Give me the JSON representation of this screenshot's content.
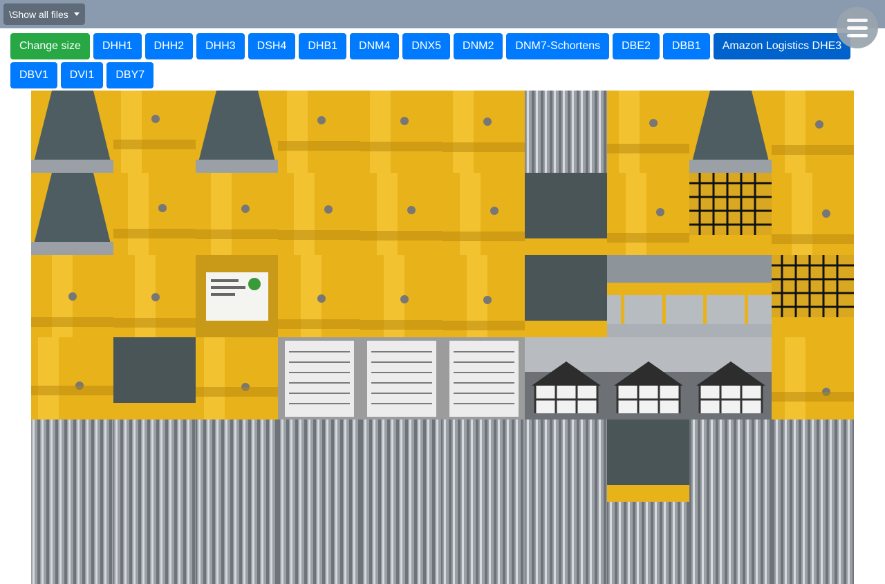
{
  "topbar": {
    "show_files_label": "\\Show all files"
  },
  "menu": {
    "icon": "hamburger-menu-icon"
  },
  "buttons": [
    {
      "label": "Change size",
      "style": "success"
    },
    {
      "label": "DHH1",
      "style": "primary"
    },
    {
      "label": "DHH2",
      "style": "primary"
    },
    {
      "label": "DHH3",
      "style": "primary"
    },
    {
      "label": "DSH4",
      "style": "primary"
    },
    {
      "label": "DHB1",
      "style": "primary"
    },
    {
      "label": "DNM4",
      "style": "primary"
    },
    {
      "label": "DNX5",
      "style": "primary"
    },
    {
      "label": "DNM2",
      "style": "primary"
    },
    {
      "label": "DNM7-Schortens",
      "style": "primary"
    },
    {
      "label": "DBE2",
      "style": "primary"
    },
    {
      "label": "DBB1",
      "style": "primary"
    },
    {
      "label": "Amazon Logistics DHE3",
      "style": "active"
    },
    {
      "label": "DBV1",
      "style": "primary"
    },
    {
      "label": "DVI1",
      "style": "primary"
    },
    {
      "label": "DBY7",
      "style": "primary"
    }
  ],
  "colors": {
    "topbar": "#8a9bb0",
    "primary": "#007bff",
    "success": "#28a745",
    "active": "#0062cc",
    "conveyor_yellow": "#e8b21a"
  },
  "thumbnails": [
    "c",
    "y",
    "c",
    "y",
    "y",
    "y",
    "r",
    "y",
    "c",
    "y",
    "c",
    "y",
    "y",
    "y",
    "y",
    "y",
    "b",
    "y",
    "n",
    "y",
    "y",
    "y",
    "l",
    "y",
    "y",
    "y",
    "b",
    "w",
    "w",
    "n",
    "y",
    "b",
    "y",
    "d",
    "d",
    "d",
    "h",
    "h",
    "h",
    "y",
    "r",
    "r",
    "r",
    "r",
    "r",
    "r",
    "r",
    "b",
    "r",
    "r",
    "r",
    "r",
    "r",
    "r",
    "r",
    "r",
    "r",
    "r",
    "r",
    "r"
  ]
}
